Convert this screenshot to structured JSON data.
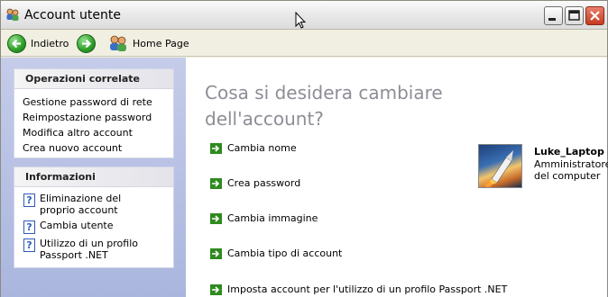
{
  "window": {
    "title": "Account utente",
    "icon": "users-icon"
  },
  "toolbar": {
    "back_label": "Indietro",
    "home_label": "Home Page"
  },
  "related_tasks": {
    "header": "Operazioni correlate",
    "items": [
      "Gestione password di rete",
      "Reimpostazione password",
      "Modifica altro account",
      "Crea nuovo account"
    ]
  },
  "info": {
    "header": "Informazioni",
    "items": [
      "Eliminazione del proprio account",
      "Cambia utente",
      "Utilizzo di un profilo Passport .NET"
    ]
  },
  "main": {
    "heading": "Cosa si desidera cambiare dell'account?",
    "tasks": [
      "Cambia nome",
      "Crea password",
      "Cambia immagine",
      "Cambia tipo di account",
      "Imposta account per l'utilizzo di un profilo Passport .NET"
    ]
  },
  "user": {
    "name": "Luke_Laptop",
    "role": "Amministratore del computer"
  },
  "colors": {
    "accent_green": "#2f8a1f",
    "heading_gray": "#8d8d96",
    "left_pane": "#aab6de"
  }
}
